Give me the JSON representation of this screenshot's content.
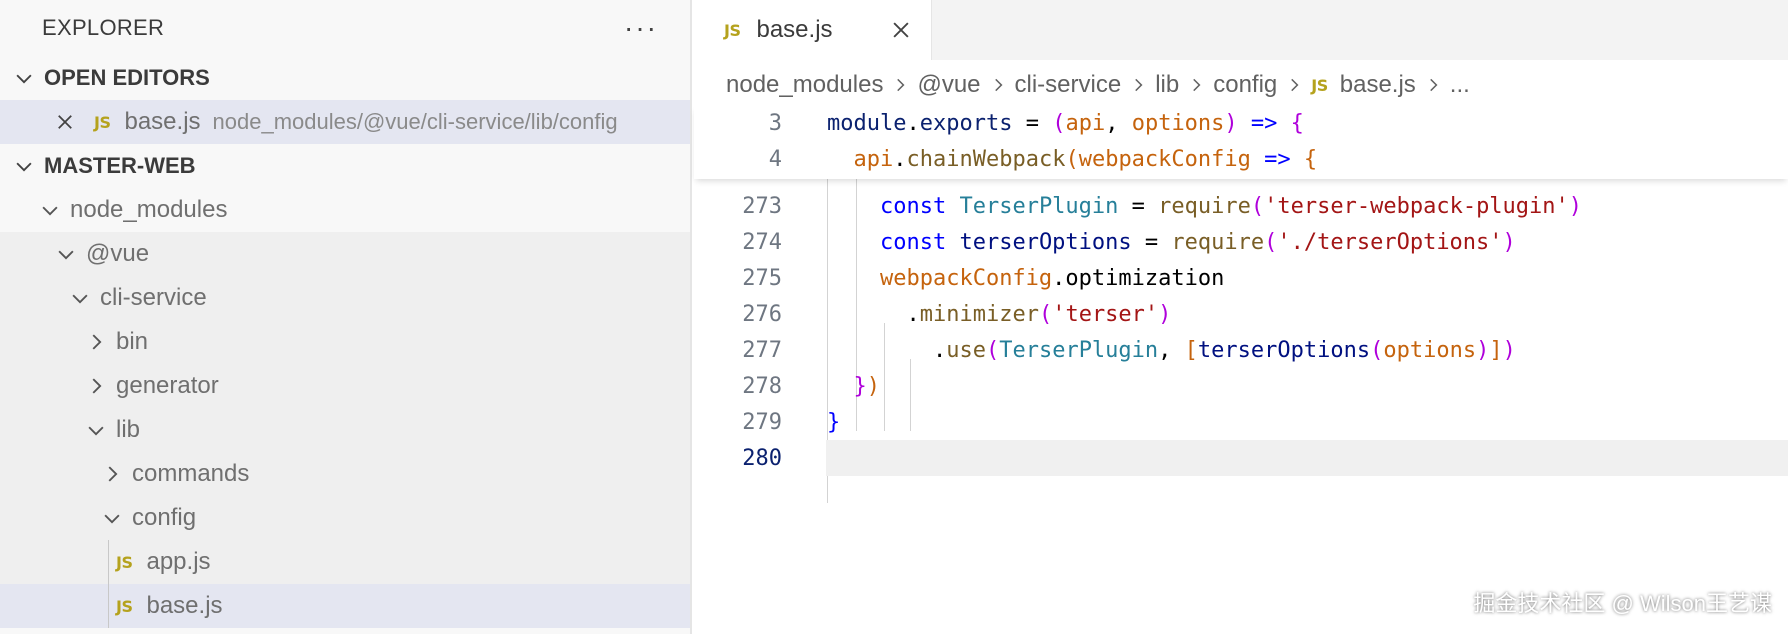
{
  "sidebar": {
    "title": "EXPLORER",
    "more_glyph": "···",
    "open_editors": {
      "label": "OPEN EDITORS",
      "items": [
        {
          "badge": "JS",
          "name": "base.js",
          "path": "node_modules/@vue/cli-service/lib/config"
        }
      ]
    },
    "workspace": {
      "label": "MASTER-WEB",
      "tree": [
        {
          "label": "node_modules",
          "state": "expanded"
        },
        {
          "label": "@vue",
          "state": "expanded"
        },
        {
          "label": "cli-service",
          "state": "expanded"
        },
        {
          "label": "bin",
          "state": "collapsed"
        },
        {
          "label": "generator",
          "state": "collapsed"
        },
        {
          "label": "lib",
          "state": "expanded"
        },
        {
          "label": "commands",
          "state": "collapsed"
        },
        {
          "label": "config",
          "state": "expanded"
        },
        {
          "label": "app.js",
          "badge": "JS"
        },
        {
          "label": "base.js",
          "badge": "JS",
          "selected": true
        }
      ]
    }
  },
  "editor": {
    "tab": {
      "badge": "JS",
      "label": "base.js"
    },
    "breadcrumb": [
      "node_modules",
      "@vue",
      "cli-service",
      "lib",
      "config"
    ],
    "breadcrumb_file": {
      "badge": "JS",
      "label": "base.js"
    },
    "breadcrumb_more": "...",
    "sticky_lines": [
      {
        "num": "3",
        "text": "module.exports = (api, options) => {"
      },
      {
        "num": "4",
        "text": "  api.chainWebpack(webpackConfig => {"
      }
    ],
    "lines": [
      {
        "num": "273",
        "text": "    const TerserPlugin = require('terser-webpack-plugin')"
      },
      {
        "num": "274",
        "text": "    const terserOptions = require('./terserOptions')"
      },
      {
        "num": "275",
        "text": "    webpackConfig.optimization"
      },
      {
        "num": "276",
        "text": "      .minimizer('terser')"
      },
      {
        "num": "277",
        "text": "        .use(TerserPlugin, [terserOptions(options)])"
      },
      {
        "num": "278",
        "text": "  })"
      },
      {
        "num": "279",
        "text": "}"
      },
      {
        "num": "280",
        "text": ""
      }
    ],
    "active_line": "280"
  },
  "watermark": "掘金技术社区 @ Wilson王艺谋",
  "colors": {
    "accent_selection": "#e4e6f1",
    "js_badge": "#b5a21d"
  }
}
